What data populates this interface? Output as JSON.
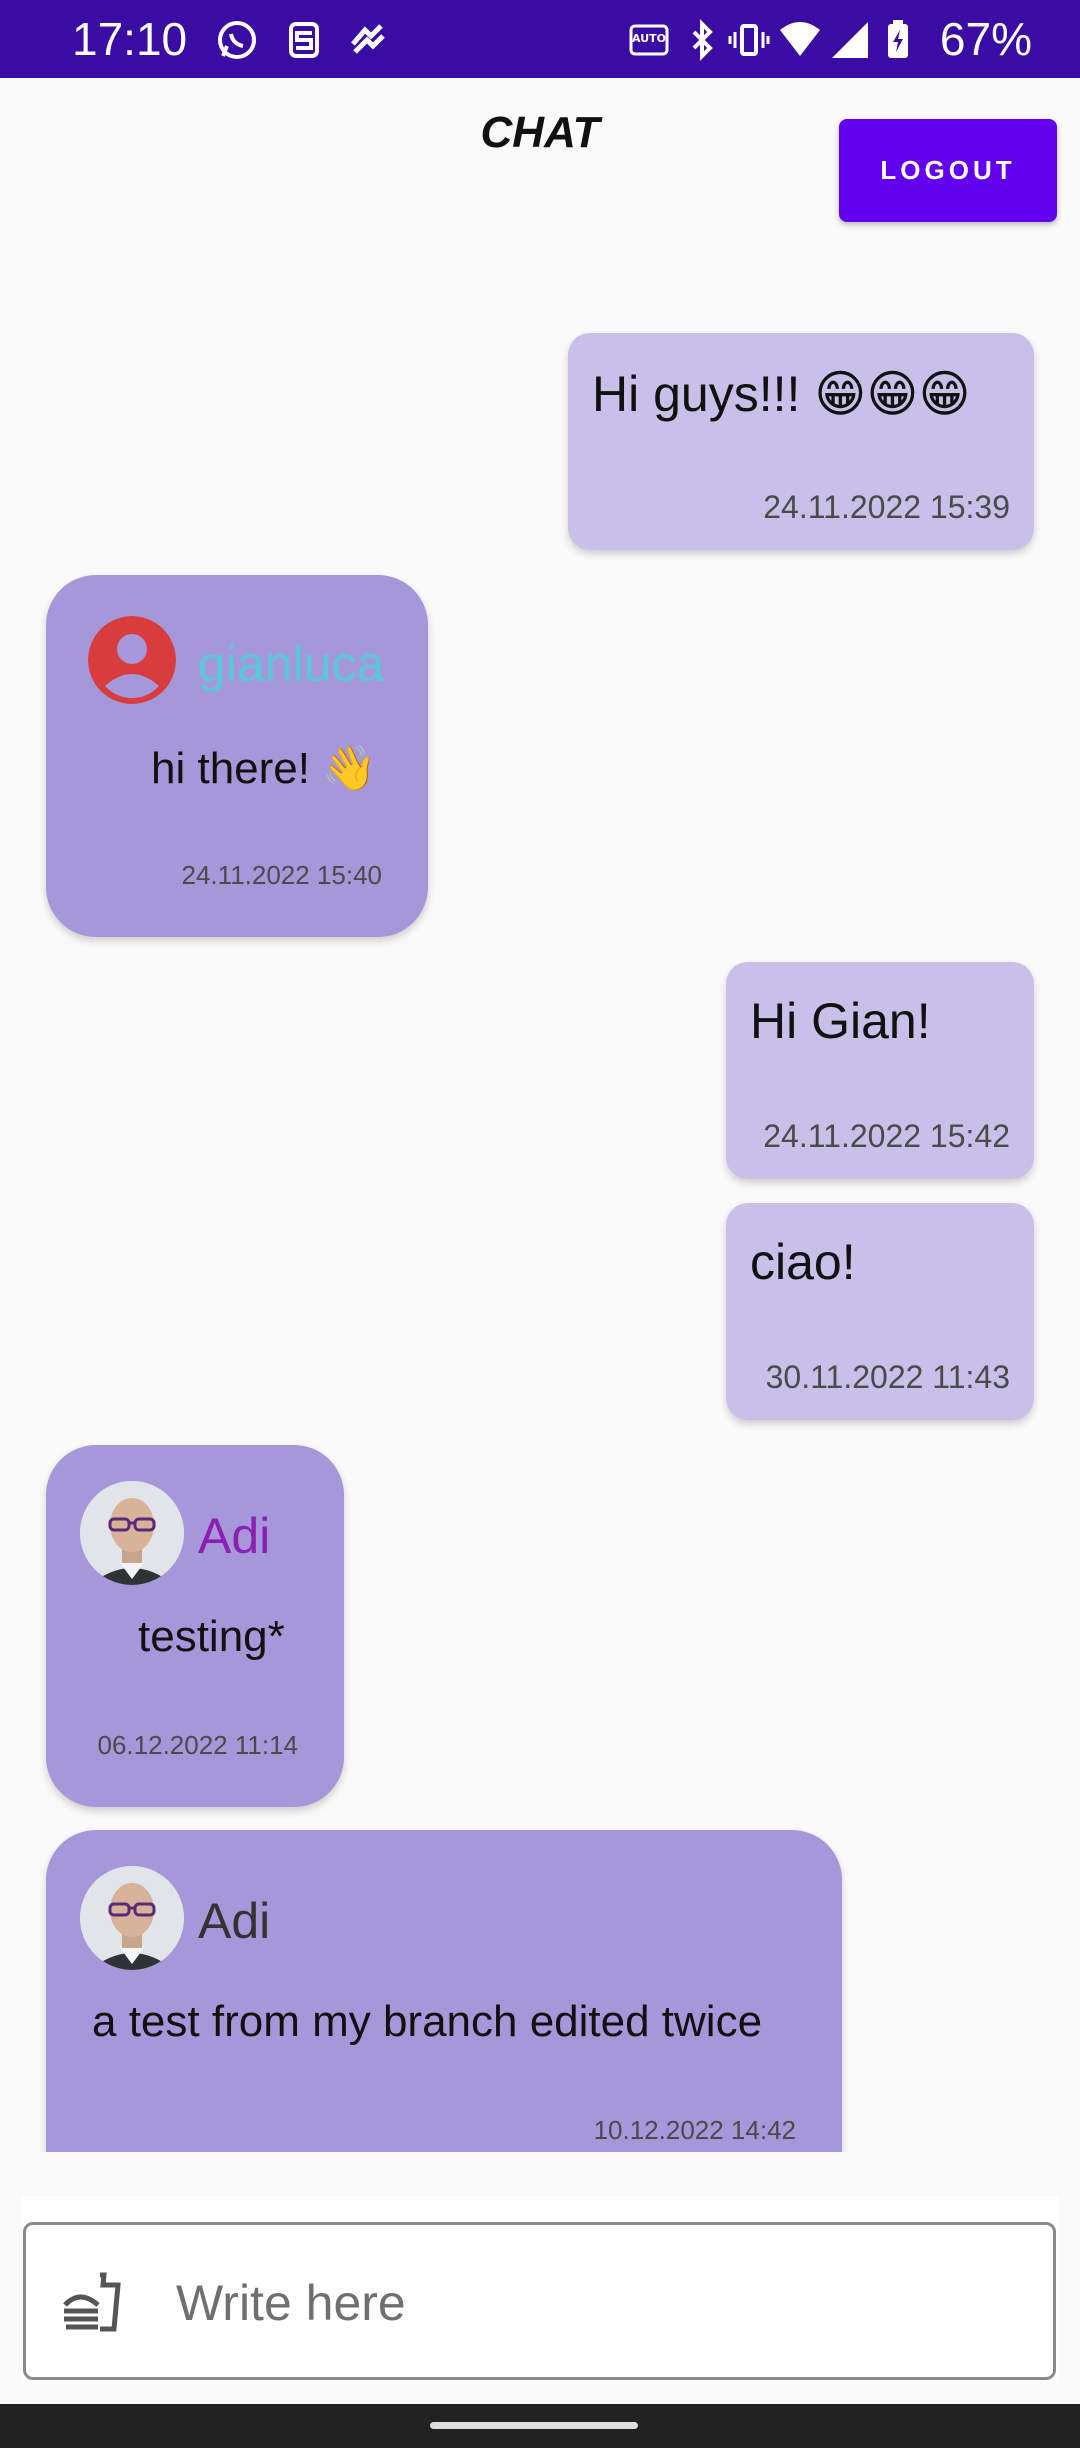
{
  "status_bar": {
    "time": "17:10",
    "battery_percent": "67%",
    "icons": [
      "whatsapp-icon",
      "s-app-icon",
      "health-app-icon",
      "auto-hz-icon",
      "bluetooth-icon",
      "vibrate-icon",
      "wifi-icon",
      "signal-icon",
      "battery-icon"
    ],
    "background": "#3a0ca3"
  },
  "header": {
    "title": "CHAT",
    "logout_label": "LOGOUT",
    "accent": "#6200ee"
  },
  "messages": [
    {
      "own": true,
      "text": "Hi guys!!! 😁😁😁",
      "time": "24.11.2022 15:39"
    },
    {
      "own": false,
      "sender": "gianluca",
      "sender_color": "#5bc8d9",
      "avatar": "default-person-icon",
      "text": "hi there! 👋",
      "time": "24.11.2022 15:40"
    },
    {
      "own": true,
      "text": "Hi Gian!",
      "time": "24.11.2022 15:42"
    },
    {
      "own": true,
      "text": "ciao!",
      "time": "30.11.2022 11:43"
    },
    {
      "own": false,
      "sender": "Adi",
      "sender_color": "#8a1fb0",
      "avatar": "photo-avatar",
      "text": "testing*",
      "time": "06.12.2022 11:14"
    },
    {
      "own": false,
      "sender": "Adi",
      "sender_color": "#333333",
      "avatar": "photo-avatar",
      "text": "a test from my branch edited twice",
      "time": "10.12.2022 14:42"
    }
  ],
  "composer": {
    "placeholder": "Write here",
    "value": "",
    "icon": "fast-food-icon"
  },
  "colors": {
    "own_bubble": "#c8c0e8",
    "other_bubble": "#a597d9"
  }
}
